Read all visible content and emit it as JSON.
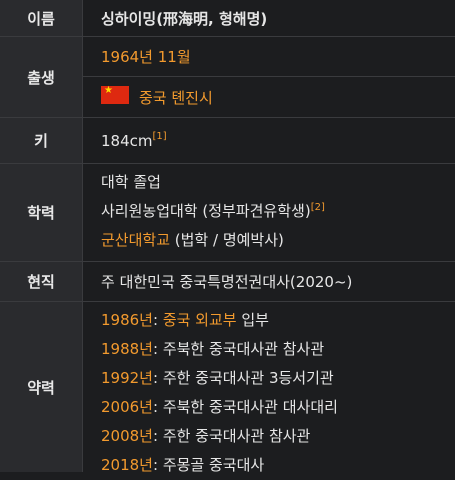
{
  "name": {
    "label": "이름",
    "value": "싱하이밍(邢海明, 형해명)"
  },
  "birth": {
    "label": "출생",
    "date": "1964년 11월",
    "place": "중국 톈진시",
    "flag_icon": "china-flag-icon"
  },
  "height": {
    "label": "키",
    "value": "184cm",
    "ref": "[1]"
  },
  "education": {
    "label": "학력",
    "line1": "대학 졸업",
    "line2": "사리원농업대학 (정부파견유학생)",
    "line2_ref": "[2]",
    "line3_link": "군산대학교",
    "line3_rest": " (법학 / 명예박사)"
  },
  "current": {
    "label": "현직",
    "value": "주 대한민국 중국특명전권대사(2020~)"
  },
  "career": {
    "label": "약력",
    "items": [
      {
        "year": "1986년",
        "sep": ": ",
        "link": "중국 외교부",
        "text": " 입부"
      },
      {
        "year": "1988년",
        "sep": ": ",
        "link": "",
        "text": "주북한 중국대사관 참사관"
      },
      {
        "year": "1992년",
        "sep": ": ",
        "link": "",
        "text": "주한 중국대사관 3등서기관"
      },
      {
        "year": "2006년",
        "sep": ": ",
        "link": "",
        "text": "주북한 중국대사관 대사대리"
      },
      {
        "year": "2008년",
        "sep": ": ",
        "link": "",
        "text": "주한 중국대사관 참사관"
      },
      {
        "year": "2018년",
        "sep": ": ",
        "link": "",
        "text": "주몽골 중국대사"
      }
    ]
  }
}
